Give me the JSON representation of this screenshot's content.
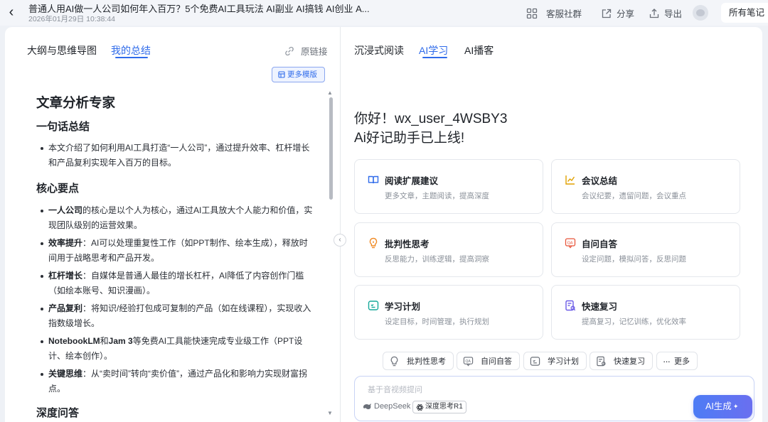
{
  "header": {
    "title": "普通人用AI做一人公司如何年入百万？5个免费AI工具玩法 AI副业 AI搞钱 AI创业 A...",
    "date": "2026年01月29日 10:38:44",
    "actions": {
      "community": "客服社群",
      "share": "分享",
      "export": "导出",
      "all_notes": "所有笔记"
    }
  },
  "left": {
    "tabs": [
      "大纲与思维导图",
      "我的总结"
    ],
    "active_tab": 1,
    "original_link": "原链接",
    "more_templates": "更多模版",
    "summary": {
      "title": "文章分析专家",
      "one_line_heading": "一句话总结",
      "one_line": "本文介绍了如何利用AI工具打造“一人公司”，通过提升效率、杠杆增长和产品复利实现年入百万的目标。",
      "key_points_heading": "核心要点",
      "key_points": [
        {
          "term": "一人公司",
          "text": "的核心是以个人为核心，通过AI工具放大个人能力和价值，实现团队级别的运营效果。"
        },
        {
          "term": "效率提升",
          "text": "：AI可以处理重复性工作（如PPT制作、绘本生成），释放时间用于战略思考和产品开发。"
        },
        {
          "term": "杠杆增长",
          "text": "：自媒体是普通人最佳的增长杠杆，AI降低了内容创作门槛（如绘本账号、知识漫画）。"
        },
        {
          "term": "产品复利",
          "text": "：将知识/经验打包成可复制的产品（如在线课程），实现收入指数级增长。"
        },
        {
          "term": "NotebookLM",
          "mid": "和",
          "term2": "Jam 3",
          "text": "等免费AI工具能快速完成专业级工作（PPT设计、绘本创作）。"
        },
        {
          "term": "关键思维",
          "text": "：从“卖时间”转向“卖价值”，通过产品化和影响力实现财富拐点。"
        }
      ],
      "qa_heading": "深度问答"
    }
  },
  "right": {
    "tabs": [
      "沉浸式阅读",
      "AI学习",
      "AI播客"
    ],
    "active_tab": 1,
    "greeting_line1": "你好！wx_user_4WSBY3",
    "greeting_line2": "Ai好记助手已上线!",
    "cards": [
      {
        "title": "阅读扩展建议",
        "desc": "更多文章，主题阅读，提高深度",
        "icon": "book-icon",
        "color": "#2f6bea"
      },
      {
        "title": "会议总结",
        "desc": "会议纪要，遗留问题，会议重点",
        "icon": "chart-icon",
        "color": "#e0a100"
      },
      {
        "title": "批判性思考",
        "desc": "反思能力，训练逻辑，提高洞察",
        "icon": "bulb-icon",
        "color": "#f08a24"
      },
      {
        "title": "自问自答",
        "desc": "设定问题，模拟问答，反思问题",
        "icon": "qa-icon",
        "color": "#e8553a"
      },
      {
        "title": "学习计划",
        "desc": "设定目标，时间管理，执行规划",
        "icon": "plan-icon",
        "color": "#16a89a"
      },
      {
        "title": "快速复习",
        "desc": "提高复习，记忆训练，优化效率",
        "icon": "review-icon",
        "color": "#6c5ce7"
      }
    ],
    "chips": [
      "批判性思考",
      "自问自答",
      "学习计划",
      "快速复习",
      "更多"
    ],
    "input_placeholder": "基于音视频提问",
    "model": "DeepSeek",
    "think_label": "深度思考R1",
    "generate_button": "AI生成"
  }
}
